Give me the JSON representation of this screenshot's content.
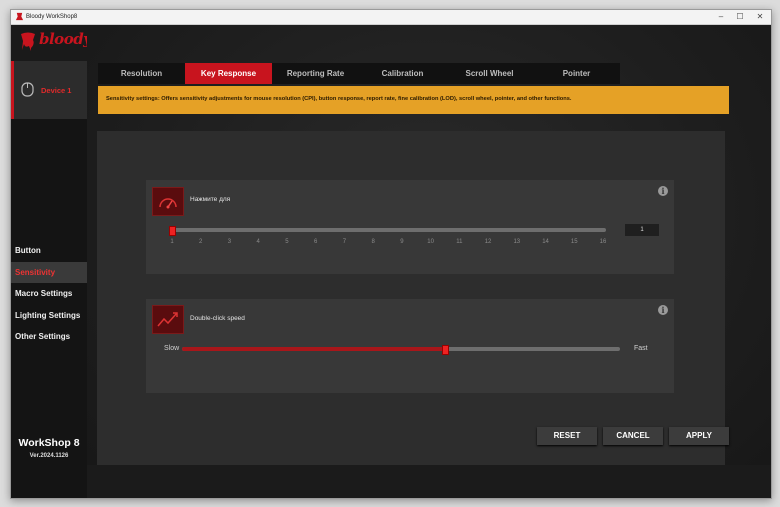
{
  "window": {
    "title": "Bloody WorkShop8",
    "controls": [
      "–",
      "☐",
      "✕"
    ]
  },
  "sidebar": {
    "logo_text": "bloody",
    "device_label": "Device 1",
    "menu": [
      {
        "label": "Button"
      },
      {
        "label": "Sensitivity"
      },
      {
        "label": "Macro Settings"
      },
      {
        "label": "Lighting Settings"
      },
      {
        "label": "Other Settings"
      }
    ],
    "brand_name": "WorkShop 8",
    "version": "Ver.2024.1126"
  },
  "tabs": [
    {
      "label": "Resolution"
    },
    {
      "label": "Key Response"
    },
    {
      "label": "Reporting Rate"
    },
    {
      "label": "Calibration"
    },
    {
      "label": "Scroll Wheel"
    },
    {
      "label": "Pointer"
    }
  ],
  "active_tab": "Key Response",
  "info_banner": "Sensitivity settings: Offers sensitivity adjustments for mouse resolution (CPI), button response, report rate, fine calibration (LOD), scroll wheel, pointer, and other functions.",
  "key_response": {
    "title": "Нажмите для",
    "ticks": [
      "1",
      "2",
      "3",
      "4",
      "5",
      "6",
      "7",
      "8",
      "9",
      "10",
      "11",
      "12",
      "13",
      "14",
      "15",
      "16"
    ],
    "value": "1"
  },
  "double_click": {
    "title": "Double-click speed",
    "slow_label": "Slow",
    "fast_label": "Fast",
    "level": 0.6
  },
  "buttons": {
    "reset": "RESET",
    "cancel": "CANCEL",
    "apply": "APPLY"
  },
  "colors": {
    "accent": "#c8141e",
    "banner": "#e5a126"
  }
}
